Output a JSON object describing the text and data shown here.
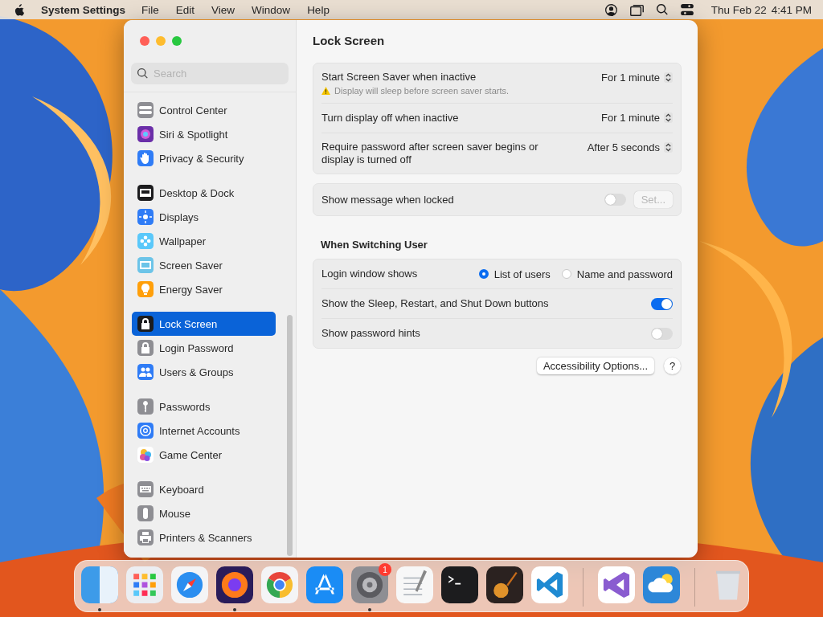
{
  "menu_bar": {
    "app_name": "System Settings",
    "menus": [
      "File",
      "Edit",
      "View",
      "Window",
      "Help"
    ],
    "date": "Thu Feb 22",
    "time": "4:41 PM"
  },
  "window": {
    "search": {
      "placeholder": "Search"
    },
    "sidebar": {
      "groups": [
        {
          "items": [
            {
              "label": "Control Center",
              "kind": "toggles",
              "color": "#8e8e93",
              "selected": false
            },
            {
              "label": "Siri & Spotlight",
              "kind": "siri",
              "color": "#6b2fa8",
              "selected": false
            },
            {
              "label": "Privacy & Security",
              "kind": "hand",
              "color": "#2f7cf6",
              "selected": false
            }
          ]
        },
        {
          "items": [
            {
              "label": "Desktop & Dock",
              "kind": "dock",
              "color": "#1c1c1e",
              "selected": false
            },
            {
              "label": "Displays",
              "kind": "sun",
              "color": "#2f7cf6",
              "selected": false
            },
            {
              "label": "Wallpaper",
              "kind": "flower",
              "color": "#5ac8fa",
              "selected": false
            },
            {
              "label": "Screen Saver",
              "kind": "screen",
              "color": "#6cc4e8",
              "selected": false
            },
            {
              "label": "Energy Saver",
              "kind": "bulb",
              "color": "#ff9f0a",
              "selected": false
            }
          ]
        },
        {
          "items": [
            {
              "label": "Lock Screen",
              "kind": "lock",
              "color": "#1c1c1e",
              "selected": true
            },
            {
              "label": "Login Password",
              "kind": "lock",
              "color": "#8e8e93",
              "selected": false
            },
            {
              "label": "Users & Groups",
              "kind": "people",
              "color": "#2f7cf6",
              "selected": false
            }
          ]
        },
        {
          "items": [
            {
              "label": "Passwords",
              "kind": "key",
              "color": "#8e8e93",
              "selected": false
            },
            {
              "label": "Internet Accounts",
              "kind": "at",
              "color": "#2f7cf6",
              "selected": false
            },
            {
              "label": "Game Center",
              "kind": "bubbles",
              "color": "#ffffff",
              "selected": false
            }
          ]
        },
        {
          "items": [
            {
              "label": "Keyboard",
              "kind": "keyboard",
              "color": "#8e8e93",
              "selected": false
            },
            {
              "label": "Mouse",
              "kind": "mouse",
              "color": "#8e8e93",
              "selected": false
            },
            {
              "label": "Printers & Scanners",
              "kind": "printer",
              "color": "#8e8e93",
              "selected": false
            }
          ]
        }
      ]
    }
  },
  "content": {
    "title": "Lock Screen",
    "sections": [
      {
        "rows": [
          {
            "kind": "popup",
            "label": "Start Screen Saver when inactive",
            "note": "Display will sleep before screen saver starts.",
            "value": "For 1 minute"
          },
          {
            "kind": "popup",
            "label": "Turn display off when inactive",
            "value": "For 1 minute"
          },
          {
            "kind": "popup",
            "label": "Require password after screen saver begins or display is turned off",
            "value": "After 5 seconds"
          }
        ]
      },
      {
        "rows": [
          {
            "kind": "toggle",
            "label": "Show message when locked",
            "on": false,
            "button": "Set...",
            "button_disabled": true
          }
        ]
      },
      {
        "heading": "When Switching User",
        "rows": [
          {
            "kind": "radio",
            "label": "Login window shows",
            "options": [
              {
                "label": "List of users",
                "selected": true
              },
              {
                "label": "Name and password",
                "selected": false
              }
            ]
          },
          {
            "kind": "toggle",
            "label": "Show the Sleep, Restart, and Shut Down buttons",
            "on": true
          },
          {
            "kind": "toggle",
            "label": "Show password hints",
            "on": false
          }
        ]
      }
    ],
    "buttons": [
      {
        "kind": "text",
        "label": "Accessibility Options..."
      },
      {
        "kind": "help",
        "label": "?"
      }
    ]
  },
  "dock": {
    "apps": [
      {
        "kind": "finder",
        "running": true
      },
      {
        "kind": "launchpad",
        "running": false
      },
      {
        "kind": "safari",
        "running": false
      },
      {
        "kind": "firefox",
        "running": true
      },
      {
        "kind": "chrome",
        "running": false
      },
      {
        "kind": "appstore",
        "running": false
      },
      {
        "kind": "settings",
        "running": true,
        "badge": "1"
      },
      {
        "kind": "textedit",
        "running": false
      },
      {
        "kind": "terminal",
        "running": false
      },
      {
        "kind": "garageband",
        "running": false
      },
      {
        "kind": "vscode",
        "running": false
      },
      {
        "kind": "separator"
      },
      {
        "kind": "vstudio",
        "running": false
      },
      {
        "kind": "weather",
        "running": false
      },
      {
        "kind": "separator"
      },
      {
        "kind": "trash",
        "running": false
      }
    ]
  }
}
